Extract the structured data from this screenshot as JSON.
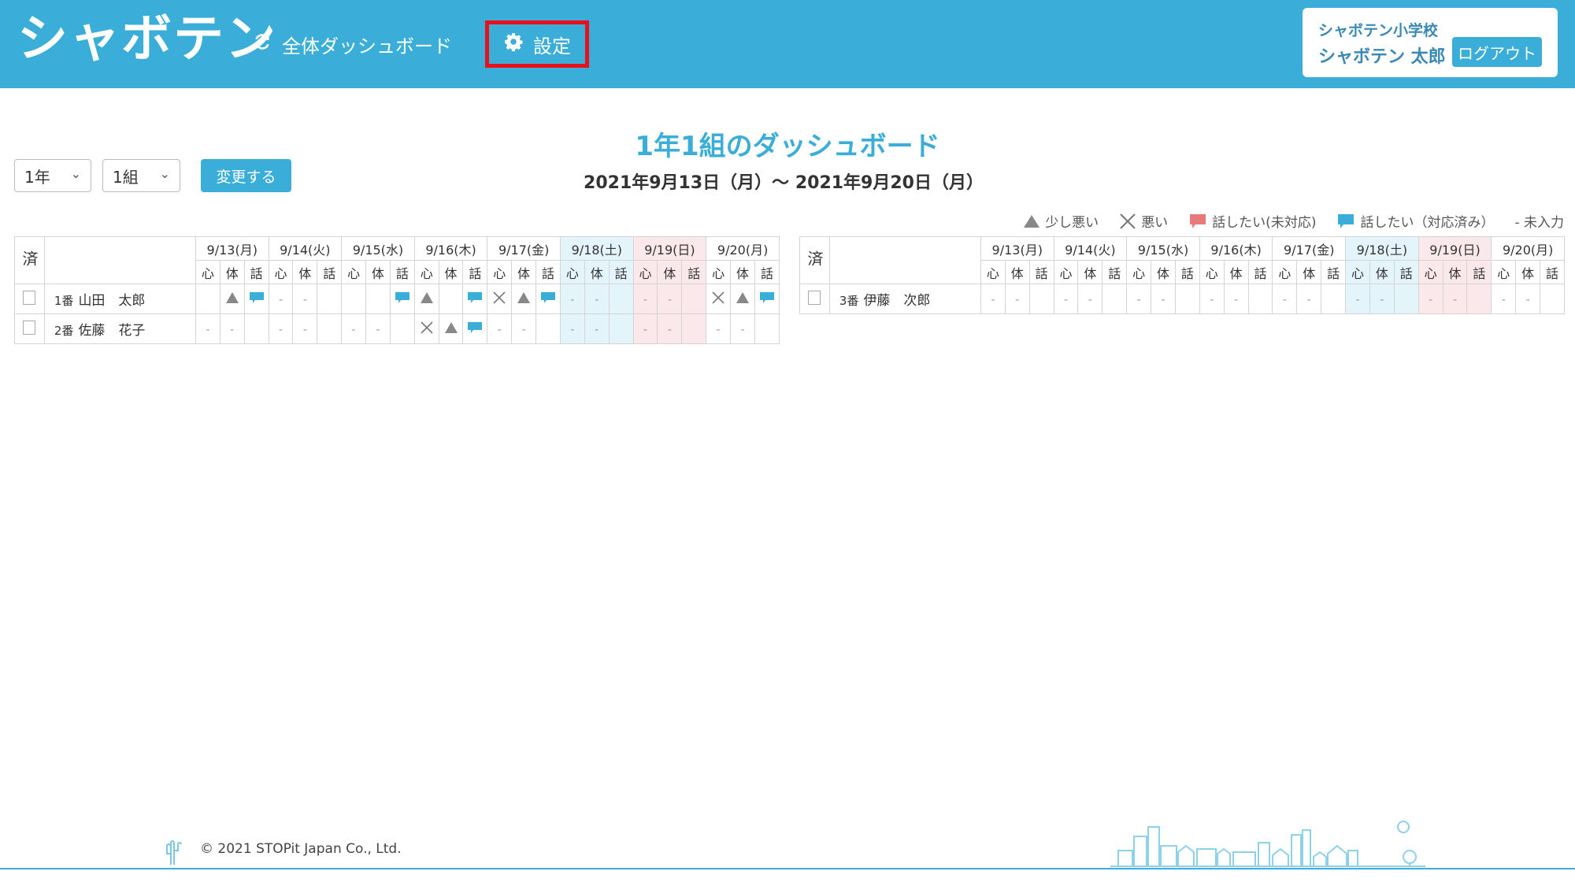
{
  "header": {
    "logo": "シャボテン",
    "nav_dashboard": "全体ダッシュボード",
    "nav_settings": "設定",
    "school": "シャボテン小学校",
    "user": "シャボテン 太郎",
    "logout": "ログアウト"
  },
  "controls": {
    "grade": "1年",
    "class": "1組",
    "change_button": "変更する"
  },
  "title": "1年1組のダッシュボード",
  "date_range": "2021年9月13日（月）～ 2021年9月20日（月）",
  "legend": {
    "slightly_bad": "少し悪い",
    "bad": "悪い",
    "talk_unhandled": "話したい(未対応)",
    "talk_handled": "話したい（対応済み）",
    "not_entered": "- 未入力"
  },
  "table": {
    "done_header": "済",
    "dates": [
      {
        "label": "9/13(月)",
        "type": "weekday"
      },
      {
        "label": "9/14(火)",
        "type": "weekday"
      },
      {
        "label": "9/15(水)",
        "type": "weekday"
      },
      {
        "label": "9/16(木)",
        "type": "weekday"
      },
      {
        "label": "9/17(金)",
        "type": "weekday"
      },
      {
        "label": "9/18(土)",
        "type": "sat"
      },
      {
        "label": "9/19(日)",
        "type": "sun"
      },
      {
        "label": "9/20(月)",
        "type": "weekday"
      }
    ],
    "sub_headers": [
      "心",
      "体",
      "話"
    ]
  },
  "left_students": [
    {
      "num": "1番",
      "name": "山田　太郎",
      "cells": [
        "",
        "tri",
        "chat",
        "-",
        "-",
        "",
        "",
        "",
        "chat",
        "tri",
        "",
        "chat",
        "x",
        "tri",
        "chat",
        "-",
        "-",
        "",
        "-",
        "-",
        "",
        "x",
        "tri",
        "chat"
      ]
    },
    {
      "num": "2番",
      "name": "佐藤　花子",
      "cells": [
        "-",
        "-",
        "",
        "-",
        "-",
        "",
        "-",
        "-",
        "",
        "x",
        "tri",
        "chat",
        "-",
        "-",
        "",
        "-",
        "-",
        "",
        "-",
        "-",
        "",
        "-",
        "-",
        ""
      ]
    }
  ],
  "right_students": [
    {
      "num": "3番",
      "name": "伊藤　次郎",
      "cells": [
        "-",
        "-",
        "",
        "-",
        "-",
        "",
        "-",
        "-",
        "",
        "-",
        "-",
        "",
        "-",
        "-",
        "",
        "-",
        "-",
        "",
        "-",
        "-",
        "",
        "-",
        "-",
        ""
      ]
    }
  ],
  "footer": {
    "copyright": "© 2021 STOPit Japan Co., Ltd."
  },
  "colors": {
    "brand": "#3aaed8",
    "highlight": "#e8101a",
    "chat_handled": "#3aaed8",
    "chat_unhandled": "#e87a7a"
  }
}
